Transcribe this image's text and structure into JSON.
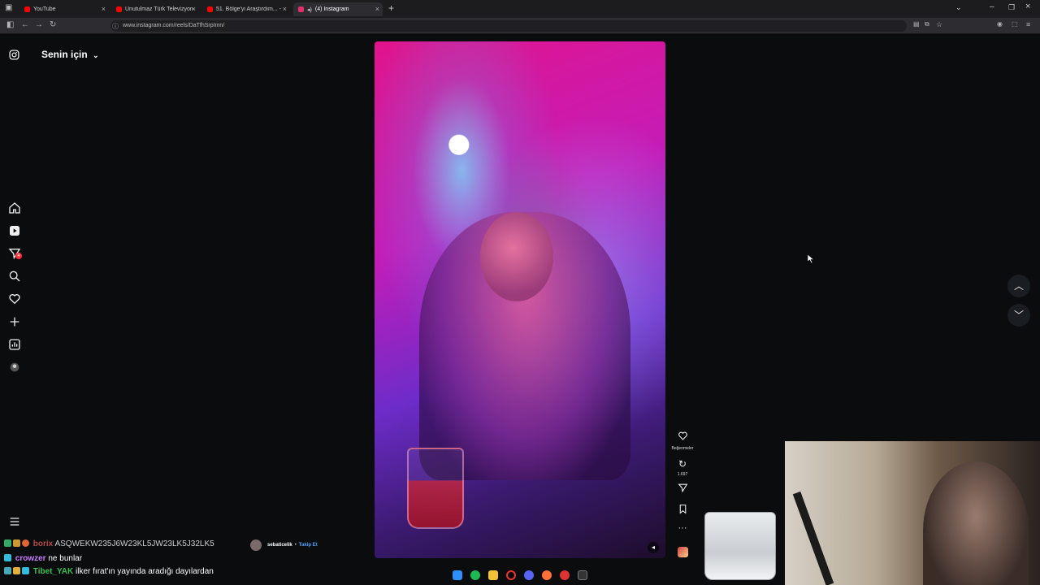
{
  "browser": {
    "tabs": [
      {
        "title": "YouTube",
        "color": "#ff0000"
      },
      {
        "title": "Unutulmaz Türk Televizyon",
        "color": "#ff0000"
      },
      {
        "title": "51. Bölge'yi Araştırdım... - YouTube",
        "color": "#ff0000"
      },
      {
        "title": "(4) Instagram",
        "color": "#e1306c"
      }
    ],
    "url": "www.instagram.com/reels/DaTfhSrpImn/"
  },
  "instagram": {
    "feed_title": "Senin için",
    "sidebar": {
      "icons": [
        "home-icon",
        "reels-icon",
        "messages-icon",
        "search-icon",
        "notifications-icon",
        "create-icon",
        "dashboard-icon",
        "profile-icon"
      ],
      "messages_badge": "4"
    },
    "actions": {
      "like_label": "Beğenmeler",
      "repost_count": "1.697"
    }
  },
  "chat": {
    "messages": [
      {
        "user": "borix",
        "text": "ASQWEKW235J6W23KL5JW23LK5J32LK5",
        "user_color": "#b64a4a"
      },
      {
        "user": "crowzer",
        "text": "ne bunlar",
        "user_color": "#c77dff"
      },
      {
        "user": "Tibet_YAK",
        "text": "ilker fırat'ın yayında aradığı dayılardan",
        "user_color": "#3fbf4f"
      }
    ],
    "follow_notice": {
      "name": "sebaticelik",
      "action": "Takip Et"
    }
  }
}
